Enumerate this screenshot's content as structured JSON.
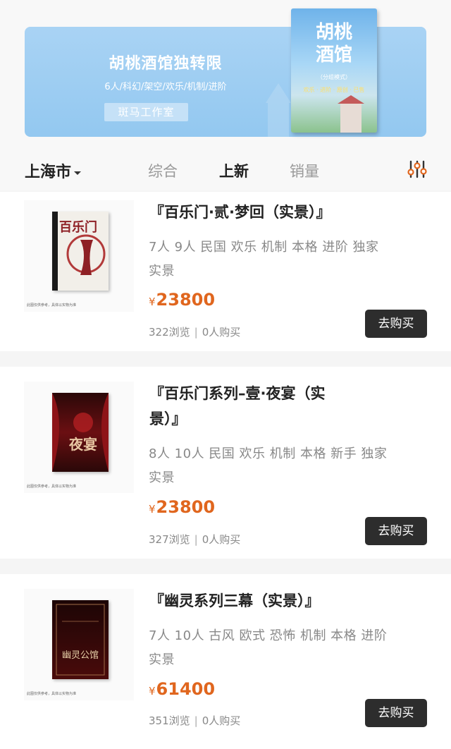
{
  "banner": {
    "title": "胡桃酒馆独转限",
    "subtitle": "6人/科幻/架空/欢乐/机制/进阶",
    "studio": "斑马工作室",
    "book_title_line1": "胡桃",
    "book_title_line2": "酒馆",
    "book_sub": "（分组模式）",
    "book_sub2": "欢乐 · 进阶 · 原创 · 已售"
  },
  "filter": {
    "city": "上海市",
    "tabs": [
      {
        "label": "综合",
        "active": false
      },
      {
        "label": "上新",
        "active": true
      },
      {
        "label": "销量",
        "active": false
      }
    ]
  },
  "products": [
    {
      "title": "『百乐门·贰·梦回（实景）』",
      "tags": "7人 9人 民国 欢乐 机制 本格 进阶 独家 实景",
      "price": "23800",
      "views": "322浏览",
      "buyers": "0人购买",
      "button": "去购买",
      "thumb_note": "此图仅供参考，具体以实物为准",
      "box_text": "百乐门"
    },
    {
      "title": "『百乐门系列–壹·夜宴（实景）』",
      "tags": "8人 10人 民国 欢乐 机制 本格 新手 独家 实景",
      "price": "23800",
      "views": "327浏览",
      "buyers": "0人购买",
      "button": "去购买",
      "thumb_note": "此图仅供参考，具体以实物为准",
      "box_text": "夜宴"
    },
    {
      "title": "『幽灵系列三幕（实景）』",
      "tags": "7人 10人 古风 欧式 恐怖 机制 本格 进阶 实景",
      "price": "61400",
      "views": "351浏览",
      "buyers": "0人购买",
      "button": "去购买",
      "thumb_note": "此图仅供参考，具体以实物为准",
      "box_text": "幽灵公馆"
    }
  ],
  "currency": "¥",
  "colors": {
    "price": "#e0661e",
    "button_bg": "#2d2d2d",
    "banner_bg": "#a9d3f4"
  }
}
